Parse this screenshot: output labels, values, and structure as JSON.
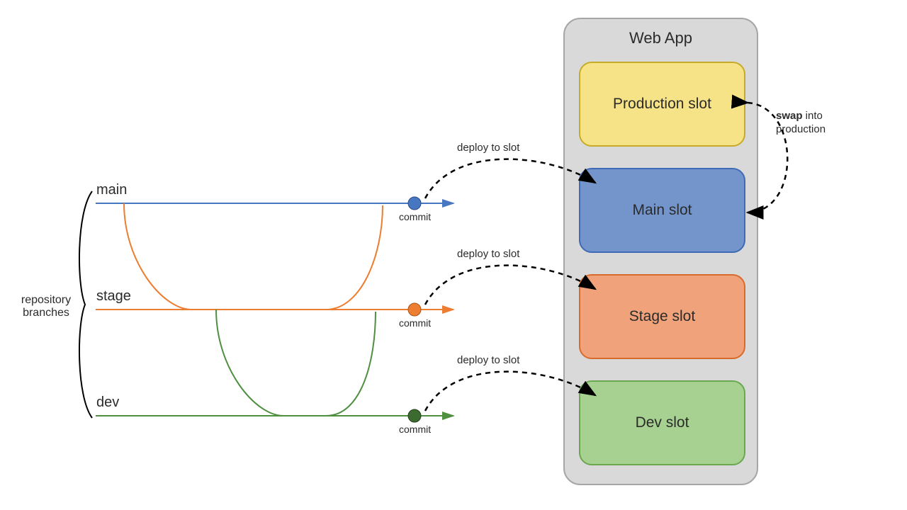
{
  "title": "Web App",
  "side_label": "repository\nbranches",
  "branches": [
    {
      "name": "main",
      "color": "#4877c2",
      "commit_label": "commit"
    },
    {
      "name": "stage",
      "color": "#ed7d31",
      "commit_label": "commit"
    },
    {
      "name": "dev",
      "color": "#4e8f40",
      "commit_label": "commit"
    }
  ],
  "deploy_label": "deploy to slot",
  "swap_label_bold": "swap",
  "swap_label_rest": " into production",
  "slots": {
    "production": {
      "label": "Production slot",
      "fill": "#f7e387",
      "stroke": "#c7aa27"
    },
    "main": {
      "label": "Main slot",
      "fill": "#7495cb",
      "stroke": "#3f6ab5"
    },
    "stage": {
      "label": "Stage slot",
      "fill": "#f0a27a",
      "stroke": "#d86b2b"
    },
    "dev": {
      "label": "Dev slot",
      "fill": "#a7d190",
      "stroke": "#6aa84f"
    }
  },
  "geometry_note": "diagram only; positions are encoded in markup"
}
